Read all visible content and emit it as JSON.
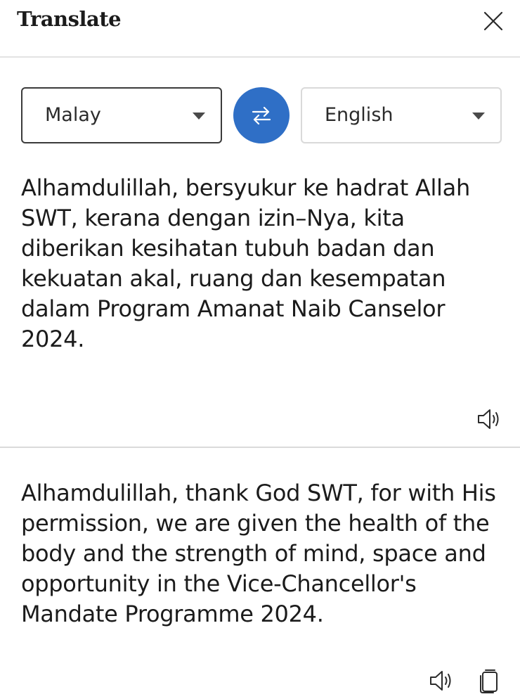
{
  "header": {
    "title": "Translate",
    "close_icon": "close-icon"
  },
  "languages": {
    "source": "Malay",
    "target": "English",
    "swap_icon": "swap-arrows-icon",
    "accent_color": "#2f6fc6"
  },
  "source": {
    "text": "Alhamdulillah, bersyukur ke hadrat Allah SWT, kerana dengan izin–Nya, kita diberikan kesihatan tubuh badan dan kekuatan akal, ruang dan kesempatan dalam Program Amanat Naib Canselor 2024.",
    "speaker_icon": "speaker-icon"
  },
  "translation": {
    "text": "Alhamdulillah, thank God SWT, for with His permission, we are given the health of the body and the strength of mind, space and opportunity in the Vice-Chancellor's Mandate Programme 2024.",
    "speaker_icon": "speaker-icon",
    "copy_icon": "copy-icon"
  }
}
